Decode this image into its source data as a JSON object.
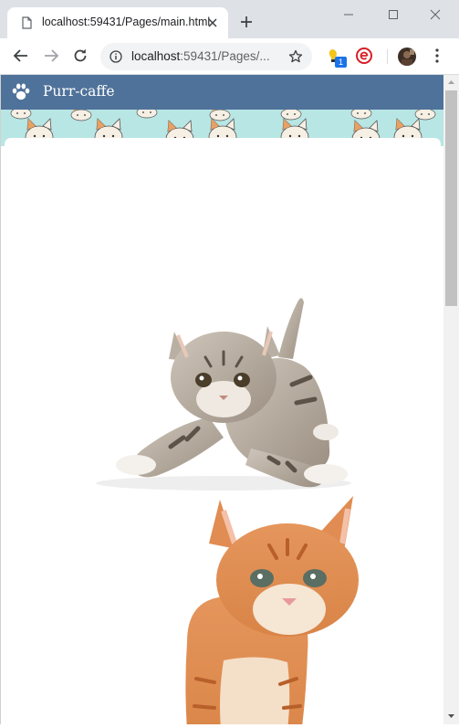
{
  "browser": {
    "tab_title": "localhost:59431/Pages/main.html",
    "url_host": "localhost",
    "url_rest": ":59431/Pages/...",
    "extension_badge": "1"
  },
  "page": {
    "brand": "Purr-caffe"
  },
  "colors": {
    "navbar": "#4f729a",
    "pattern": "#b8e6e4"
  }
}
